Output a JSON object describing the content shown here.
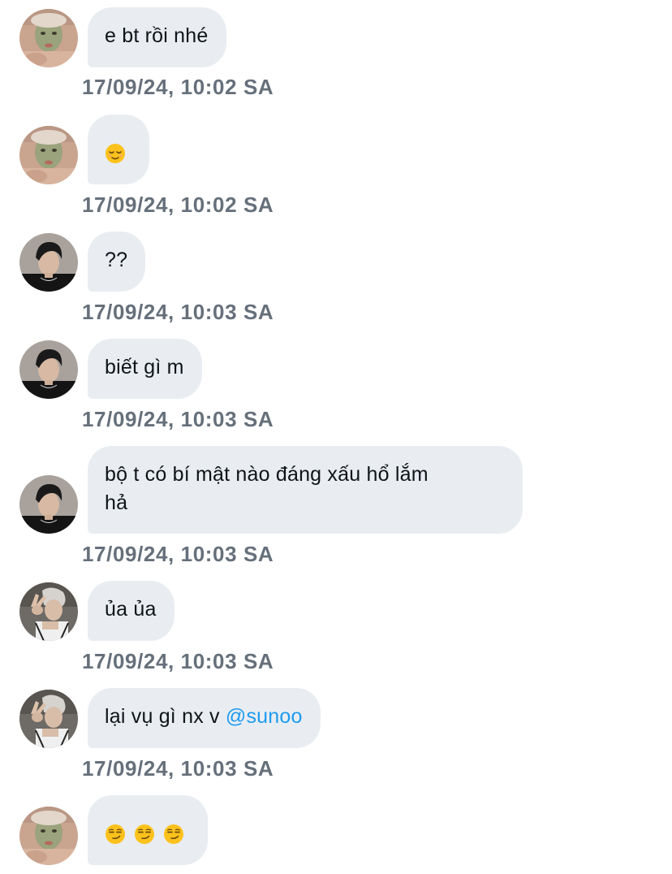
{
  "messages": [
    {
      "sender": "avatar-face-mask",
      "text": "e bt rồi nhé",
      "timestamp": "17/09/24, 10:02 SA"
    },
    {
      "sender": "avatar-face-mask",
      "emojis": [
        "relieved-face"
      ],
      "timestamp": "17/09/24, 10:02 SA"
    },
    {
      "sender": "avatar-dark-hair",
      "text": "??",
      "timestamp": "17/09/24, 10:03 SA"
    },
    {
      "sender": "avatar-dark-hair",
      "text": "biết gì m",
      "timestamp": "17/09/24, 10:03 SA"
    },
    {
      "sender": "avatar-dark-hair",
      "text_line1": "bộ t có bí mật nào đáng xấu hổ lắm",
      "text_line2": "hả",
      "timestamp": "17/09/24, 10:03 SA"
    },
    {
      "sender": "avatar-peace-sign",
      "text": "ủa ủa",
      "timestamp": "17/09/24, 10:03 SA"
    },
    {
      "sender": "avatar-peace-sign",
      "text": "lại vụ gì nx v ",
      "mention": "@sunoo",
      "timestamp": "17/09/24, 10:03 SA"
    },
    {
      "sender": "avatar-face-mask",
      "emojis": [
        "smirking-face",
        "smirking-face",
        "smirking-face"
      ]
    }
  ],
  "colors": {
    "bubble": "#e9edf1",
    "text": "#0f1419",
    "timestamp": "#66707b",
    "mention": "#1d9bf0"
  }
}
